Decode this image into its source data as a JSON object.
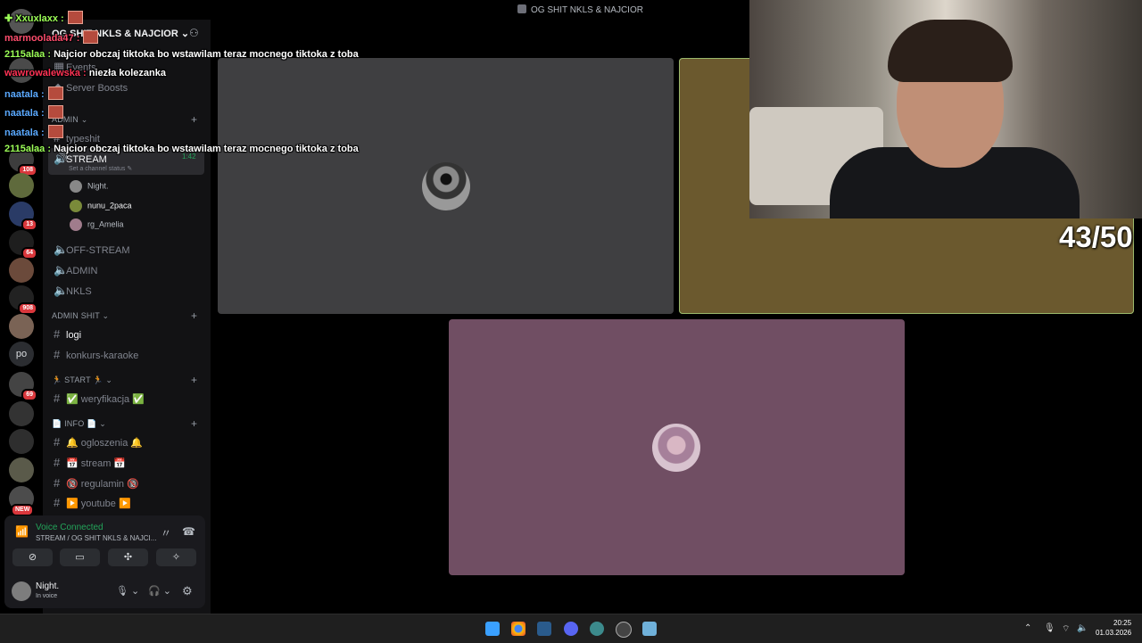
{
  "window": {
    "title": "OG SHIT NKLS & NAJCIOR"
  },
  "server": {
    "name": "OG SHIT NKLS & NAJCIOR"
  },
  "server_rail": [
    {
      "badge": ""
    },
    {
      "badge": "108"
    },
    {
      "badge": ""
    },
    {
      "badge": "13"
    },
    {
      "badge": "64"
    },
    {
      "badge": ""
    },
    {
      "badge": "908"
    },
    {
      "badge": ""
    },
    {
      "label": "po"
    },
    {
      "badge": "69"
    },
    {
      "badge": ""
    },
    {
      "badge": ""
    },
    {
      "badge": ""
    },
    {
      "badge": "NEW"
    }
  ],
  "sidebar": {
    "events": "Events",
    "boosts": "Server Boosts",
    "cat_admin": "ADMIN",
    "typeshit": "typeshit",
    "stream": "STREAM",
    "stream_time": "1:42",
    "stream_status": "Set a channel status",
    "members": [
      "Night.",
      "nunu_2paca",
      "rg_Amelia"
    ],
    "off_stream": "OFF-STREAM",
    "admin": "ADMIN",
    "nkls": "NKLS",
    "cat_admin_shit": "ADMIN SHIT",
    "logi": "logi",
    "konkurs": "konkurs-karaoke",
    "cat_start": "🏃 START 🏃",
    "weryfikacja": "✅ weryfikacja ✅",
    "cat_info": "📄 INFO 📄",
    "ogloszenia": "🔔 ogloszenia 🔔",
    "stream_ch": "📅 stream 📅",
    "regulamin": "🔞 regulamin 🔞",
    "youtube": "▶️ youtube ▶️"
  },
  "voice": {
    "status": "Voice Connected",
    "channel": "STREAM / OG SHIT NKLS & NAJCI...",
    "user": "Night.",
    "user_status": "In voice"
  },
  "overlay": {
    "counter": "43/50",
    "chat": [
      {
        "user": "✚ Xxuxlaxx :",
        "text": "",
        "color": "#9cff57",
        "emote": true
      },
      {
        "user": "marmoolada47 :",
        "text": "",
        "color": "#ff4d6d",
        "emote": true
      },
      {
        "user": "2115alaa :",
        "text": "Najcior obczaj tiktoka bo wstawilam teraz mocnego tiktoka z toba",
        "color": "#9cff57",
        "emote": false
      },
      {
        "user": "wawrowalewska :",
        "text": "niezła kolezanka",
        "color": "#ff3355",
        "emote": false
      },
      {
        "user": "naatala :",
        "text": "",
        "color": "#5aa9ff",
        "emote": true
      },
      {
        "user": "naatala :",
        "text": "",
        "color": "#5aa9ff",
        "emote": true
      },
      {
        "user": "naatala :",
        "text": "",
        "color": "#5aa9ff",
        "emote": true
      },
      {
        "user": "2115alaa :",
        "text": "Najcior obczaj tiktoka bo wstawilam teraz mocnego tiktoka z toba",
        "color": "#9cff57",
        "emote": false
      }
    ]
  },
  "taskbar": {
    "time": "20:25",
    "date": "01.03.2026"
  }
}
